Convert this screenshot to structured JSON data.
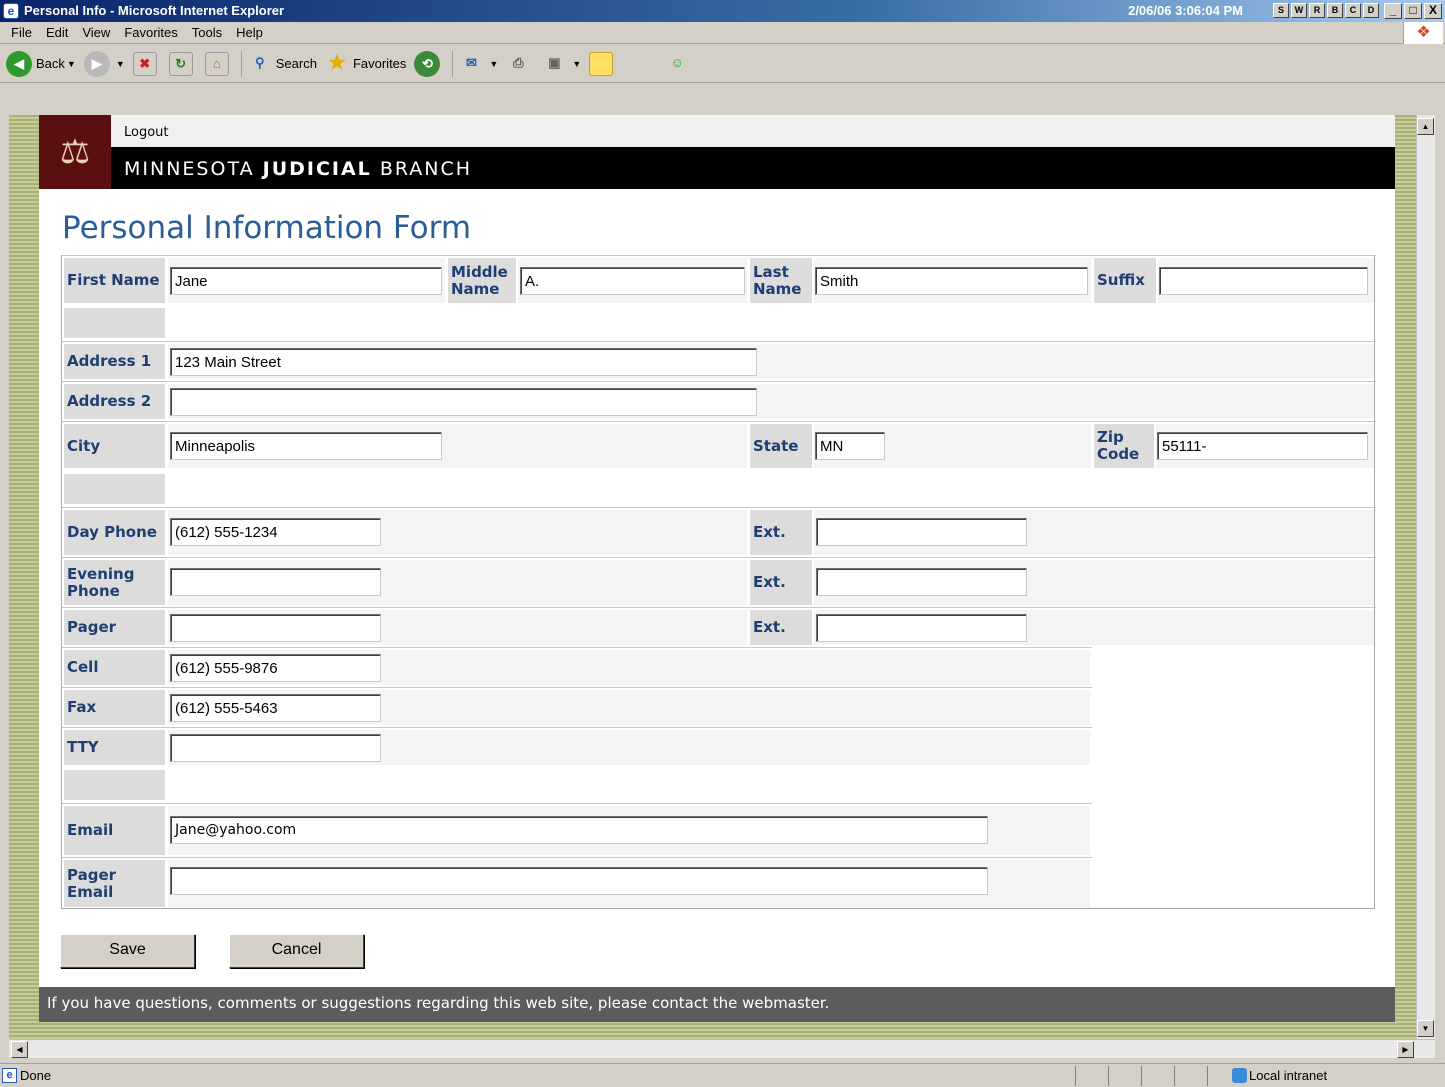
{
  "window": {
    "title": "Personal Info - Microsoft Internet Explorer",
    "clock": "2/06/06 3:06:04 PM",
    "sys_buttons": [
      "S",
      "W",
      "R",
      "B",
      "C",
      "D"
    ],
    "win_buttons": [
      "_",
      "□",
      "X"
    ]
  },
  "menu": [
    "File",
    "Edit",
    "View",
    "Favorites",
    "Tools",
    "Help"
  ],
  "toolbar": {
    "back": "Back",
    "search": "Search",
    "favorites": "Favorites"
  },
  "site": {
    "logout": "Logout",
    "brand_1": "MINNESOTA",
    "brand_2": "JUDICIAL",
    "brand_3": "BRANCH",
    "page_title": "Personal Information Form"
  },
  "labels": {
    "first_name": "First Name",
    "middle_name": "Middle Name",
    "last_name": "Last Name",
    "suffix": "Suffix",
    "address1": "Address 1",
    "address2": "Address 2",
    "city": "City",
    "state": "State",
    "zip": "Zip Code",
    "day_phone": "Day Phone",
    "evening_phone": "Evening Phone",
    "pager": "Pager",
    "ext": "Ext.",
    "cell": "Cell",
    "fax": "Fax",
    "tty": "TTY",
    "email": "Email",
    "pager_email": "Pager Email"
  },
  "values": {
    "first_name": "Jane",
    "middle_name": "A.",
    "last_name": "Smith",
    "suffix": "",
    "address1": "123 Main Street",
    "address2": "",
    "city": "Minneapolis",
    "state": "MN",
    "zip": "55111-",
    "day_phone": "(612) 555-1234",
    "day_ext": "",
    "evening_phone": "",
    "evening_ext": "",
    "pager": "",
    "pager_ext": "",
    "cell": "(612) 555-9876",
    "fax": "(612) 555-5463",
    "tty": "",
    "email": "Jane@yahoo.com",
    "pager_email": ""
  },
  "buttons": {
    "save": "Save",
    "cancel": "Cancel"
  },
  "footer": "If you have questions, comments or suggestions regarding this web site, please contact the webmaster.",
  "status": {
    "done": "Done",
    "zone": "Local intranet"
  },
  "colors": {
    "title_blue": "#2b5e96",
    "label_navy": "#1f3e72",
    "header_black": "#000000",
    "logo_maroon": "#5a1010",
    "footer_gray": "#5c5c5c"
  }
}
